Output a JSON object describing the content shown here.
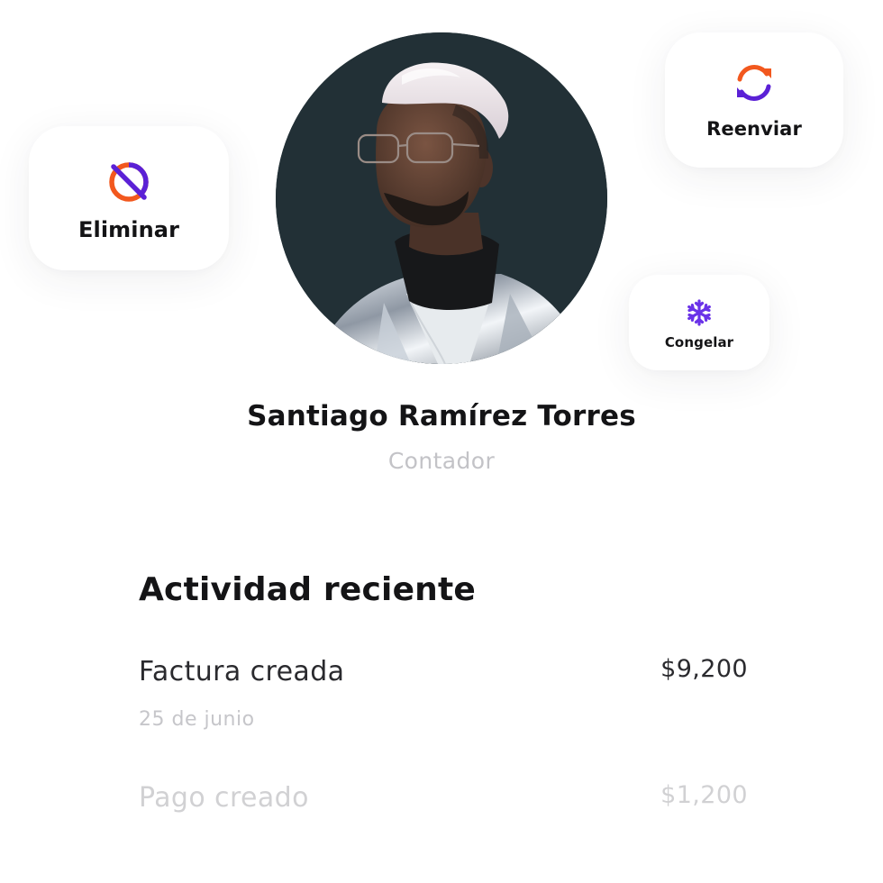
{
  "actions": {
    "delete": {
      "label": "Eliminar",
      "icon": "block-icon"
    },
    "resend": {
      "label": "Reenviar",
      "icon": "refresh-icon"
    },
    "freeze": {
      "label": "Congelar",
      "icon": "snowflake-icon"
    }
  },
  "colors": {
    "accent_purple": "#5b21d6",
    "accent_orange": "#f2581e",
    "freeze_purple": "#6a32e8",
    "text_primary": "#141416",
    "text_muted": "#c3c3c7",
    "avatar_background": "#223036"
  },
  "profile": {
    "name": "Santiago Ramírez Torres",
    "role": "Contador"
  },
  "activity": {
    "heading": "Actividad reciente",
    "items": [
      {
        "title": "Factura creada",
        "amount": "$9,200",
        "date": "25 de junio"
      },
      {
        "title": "Pago creado",
        "amount": "$1,200"
      }
    ]
  }
}
